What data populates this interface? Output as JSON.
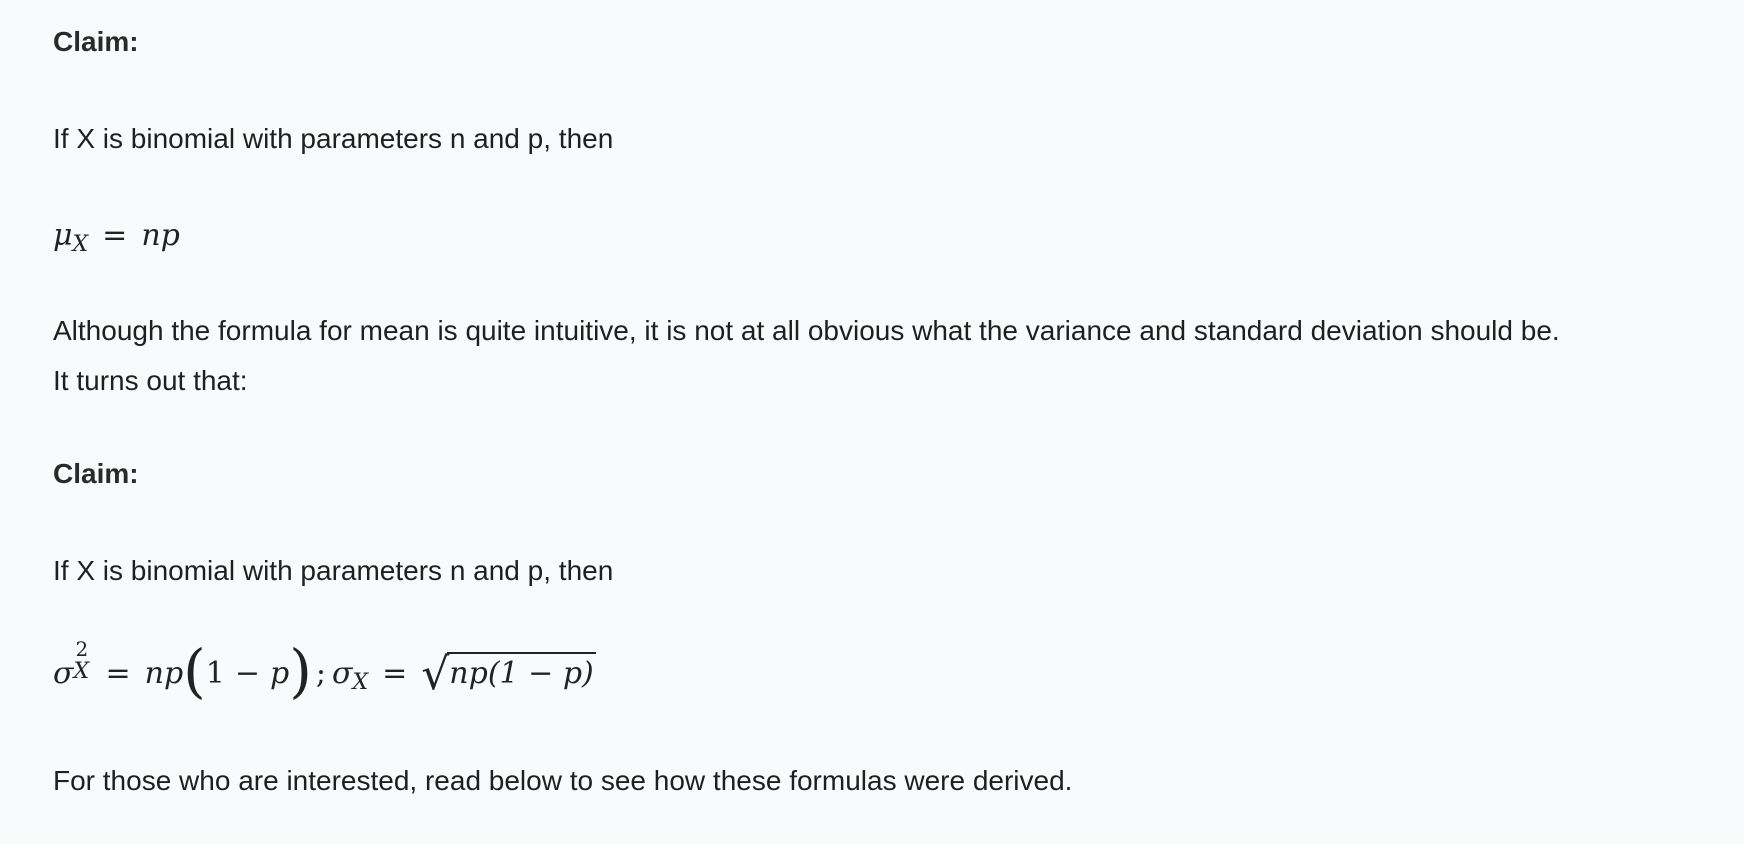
{
  "claim1": {
    "heading": "Claim:",
    "text": "If X is binomial with parameters n and p, then"
  },
  "mean_formula": {
    "lhs": "μ",
    "lhs_sub": "X",
    "eq": "=",
    "rhs": "np"
  },
  "paragraph": {
    "line1": "Although the formula for mean is quite intuitive, it is not at all obvious what the variance and standard deviation should be.",
    "line2": "It turns out that:"
  },
  "claim2": {
    "heading": "Claim:",
    "text": "If X is binomial with parameters n and p, then"
  },
  "variance_formula": {
    "sigma": "σ",
    "sub": "X",
    "sup": "2",
    "eq": "=",
    "np": "np",
    "one": "1",
    "minus": "−",
    "p": "p",
    "sep": ";",
    "sd_sigma": "σ",
    "sd_sub": "X",
    "eq2": "=",
    "radicand": "np(1 − p)"
  },
  "footer": {
    "text": "For those who are interested, read below to see how these formulas were derived."
  }
}
